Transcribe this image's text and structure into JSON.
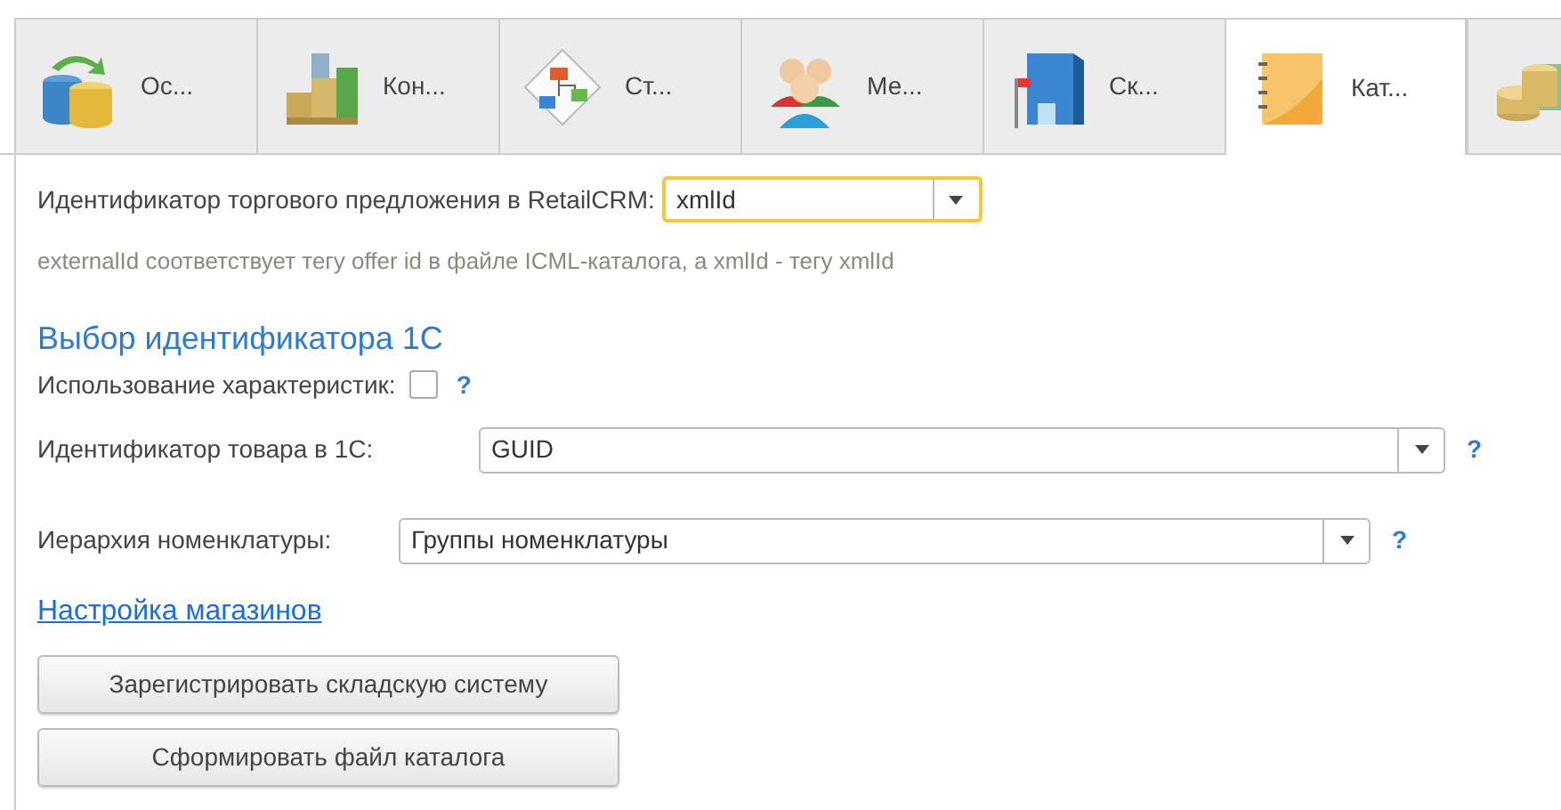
{
  "tabs": [
    {
      "label": "Ос...",
      "selected": false
    },
    {
      "label": "Кон...",
      "selected": false
    },
    {
      "label": "Ст...",
      "selected": false
    },
    {
      "label": "Ме...",
      "selected": false
    },
    {
      "label": "Ск...",
      "selected": false
    },
    {
      "label": "Кат...",
      "selected": true
    },
    {
      "selected": false
    }
  ],
  "offer_id": {
    "label": "Идентификатор торгового предложения в RetailCRM:",
    "value": "xmlId",
    "focused": true,
    "hint": "externalId соответствует тегу offer id в файле ICML-каталога, а xmlId - тегу xmlId"
  },
  "section_title": "Выбор идентификатора 1С",
  "characteristics": {
    "label": "Использование характеристик:",
    "checked": false,
    "help": "?"
  },
  "product_id": {
    "label": "Идентификатор товара в 1С:",
    "value": "GUID",
    "help": "?"
  },
  "hierarchy": {
    "label": "Иерархия номенклатуры:",
    "value": "Группы номенклатуры",
    "help": "?"
  },
  "link": "Настройка магазинов",
  "buttons": [
    "Зарегистрировать складскую систему",
    "Сформировать файл каталога"
  ]
}
